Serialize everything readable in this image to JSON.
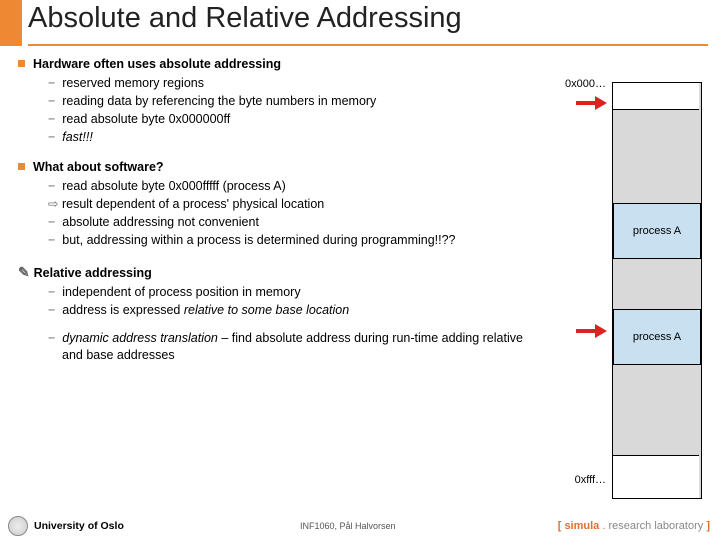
{
  "title": "Absolute and Relative Addressing",
  "sections": {
    "hw": {
      "heading": "Hardware often uses absolute addressing",
      "items": [
        "reserved memory regions",
        "reading data by referencing the byte numbers in memory",
        "read absolute byte 0x000000ff",
        "fast!!!"
      ]
    },
    "sw": {
      "heading": "What about software?",
      "items": [
        "read absolute byte 0x000fffff (process A)",
        "result dependent of a process' physical location",
        "absolute addressing not convenient",
        "but, addressing within a process is determined during programming!!??"
      ]
    },
    "rel": {
      "heading": "Relative addressing",
      "items": [
        "independent of process position in memory",
        "address is expressed relative to some base location",
        "dynamic address translation – find absolute address during run-time adding relative and base addresses"
      ]
    }
  },
  "memory": {
    "top_label": "0x000…",
    "bottom_label": "0xfff…",
    "procA": "process A"
  },
  "footer": {
    "uio": "University of Oslo",
    "course": "INF1060,   Pål Halvorsen",
    "simula_open": "[",
    "simula_name": "simula",
    "simula_dot": ".",
    "simula_rest": "research laboratory",
    "simula_close": "]"
  }
}
